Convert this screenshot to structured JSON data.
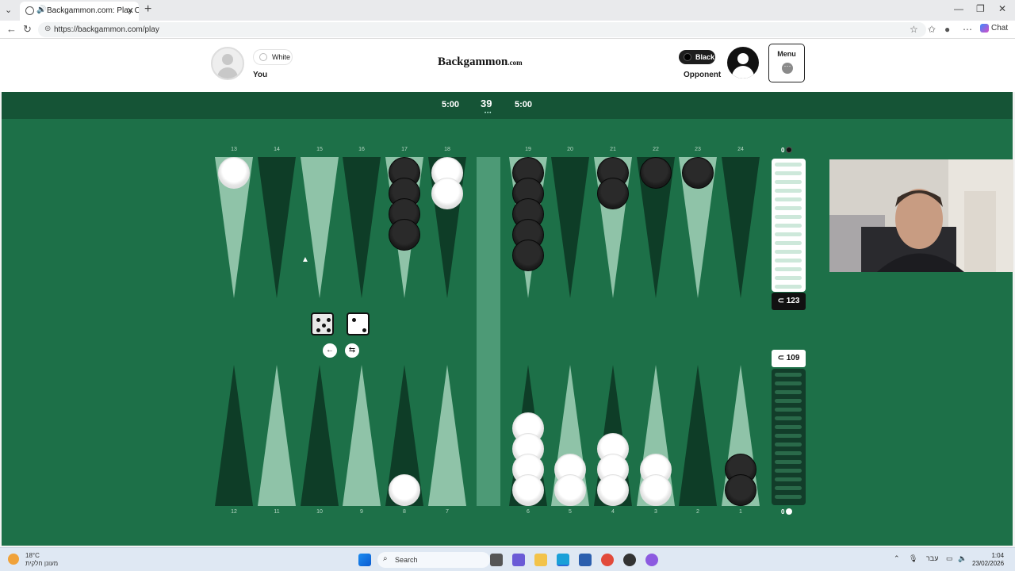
{
  "browser": {
    "tab_title": "Backgammon.com: Play Online Backgammon",
    "url": "https://backgammon.com/play",
    "chat_label": "Chat"
  },
  "header": {
    "logo_main": "Backgammon",
    "logo_suffix": ".com",
    "player_color_label": "White",
    "player_name": "You",
    "opponent_color_label": "Black",
    "opponent_name": "Opponent",
    "menu_label": "Menu",
    "menu_dots": "···"
  },
  "timers": {
    "player_time": "5:00",
    "opponent_time": "5:00",
    "move_number": "39",
    "move_dots": "•••"
  },
  "board": {
    "top_points": [
      "13",
      "14",
      "15",
      "16",
      "17",
      "18",
      "19",
      "20",
      "21",
      "22",
      "23",
      "24"
    ],
    "bottom_points": [
      "12",
      "11",
      "10",
      "9",
      "8",
      "7",
      "6",
      "5",
      "4",
      "3",
      "2",
      "1"
    ],
    "checkers": {
      "13": {
        "color": "white",
        "count": 1
      },
      "17": {
        "color": "black",
        "count": 4
      },
      "18": {
        "color": "white",
        "count": 2
      },
      "19": {
        "color": "black",
        "count": 5
      },
      "21": {
        "color": "black",
        "count": 2
      },
      "22": {
        "color": "black",
        "count": 1
      },
      "23": {
        "color": "black",
        "count": 1
      },
      "8": {
        "color": "white",
        "count": 1
      },
      "6": {
        "color": "white",
        "count": 4
      },
      "5": {
        "color": "white",
        "count": 2
      },
      "4": {
        "color": "white",
        "count": 3
      },
      "3": {
        "color": "white",
        "count": 2
      },
      "1": {
        "color": "black",
        "count": 2
      }
    },
    "dice": [
      5,
      2
    ],
    "undo_icon": "arrow-left-icon",
    "swap_icon": "swap-arrows-icon",
    "black_borne_off": "0",
    "white_borne_off": "0",
    "black_pip": "123",
    "white_pip": "109",
    "pip_icon": "⊂"
  },
  "taskbar": {
    "temperature": "18°C",
    "weather_text": "מעונן חלקית",
    "search_label": "Search",
    "language": "עבר",
    "time": "1:04",
    "date": "23/02/2026"
  },
  "colors": {
    "felt": "#1d7048",
    "timer_bar": "#155436",
    "point_light": "#8fc3a8",
    "point_dark": "#0e3d27"
  }
}
